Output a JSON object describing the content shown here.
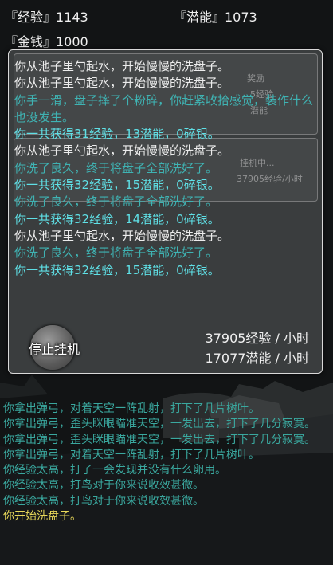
{
  "stats": {
    "exp_label": "『经验』1143",
    "potential_label": "『潜能』1073",
    "money_label": "『金钱』1000"
  },
  "ghost": {
    "reward": "奖励",
    "reward_sub": "5经验",
    "potential": "潜能",
    "idle": "挂机中...",
    "idle_rate": "37905经验/小时"
  },
  "log": [
    {
      "text": "你从池子里勺起水，开始慢慢的洗盘子。",
      "color": "white"
    },
    {
      "text": "你从池子里勺起水，开始慢慢的洗盘子。",
      "color": "white"
    },
    {
      "text": "你手一滑，盘子摔了个粉碎，你赶紧收拾感觉，装作什么也没发生。",
      "color": "teal"
    },
    {
      "text": "你一共获得31经验，13潜能，0碎银。",
      "color": "cyan"
    },
    {
      "text": "你从池子里勺起水，开始慢慢的洗盘子。",
      "color": "white"
    },
    {
      "text": "你洗了良久，终于将盘子全部洗好了。",
      "color": "teal"
    },
    {
      "text": "你一共获得32经验，15潜能，0碎银。",
      "color": "cyan"
    },
    {
      "text": "你洗了良久，终于将盘子全部洗好了。",
      "color": "teal"
    },
    {
      "text": "你一共获得32经验，14潜能，0碎银。",
      "color": "cyan"
    },
    {
      "text": "你从池子里勺起水，开始慢慢的洗盘子。",
      "color": "white"
    },
    {
      "text": "你洗了良久，终于将盘子全部洗好了。",
      "color": "teal"
    },
    {
      "text": "你一共获得32经验，15潜能，0碎银。",
      "color": "cyan"
    }
  ],
  "stop_button": "停止挂机",
  "rates": {
    "exp": "37905经验 / 小时",
    "potential": "17077潜能 / 小时"
  },
  "chat": [
    {
      "text": "你拿出弹弓，对着天空一阵乱射，打下了几片树叶。",
      "hl": false
    },
    {
      "text": "你拿出弹弓，歪头眯眼瞄准天空，一发出去，打下了几分寂寞。",
      "hl": false
    },
    {
      "text": "你拿出弹弓，歪头眯眼瞄准天空，一发出去，打下了几分寂寞。",
      "hl": false
    },
    {
      "text": "你拿出弹弓，对着天空一阵乱射，打下了几片树叶。",
      "hl": false
    },
    {
      "text": "你经验太高，打了一会发现并没有什么卵用。",
      "hl": false
    },
    {
      "text": "你经验太高，打鸟对于你来说收效甚微。",
      "hl": false
    },
    {
      "text": "你经验太高，打鸟对于你来说收效甚微。",
      "hl": false
    },
    {
      "text": "你开始洗盘子。",
      "hl": true
    }
  ],
  "colors": {
    "white": "#ececec",
    "teal": "#3fb3b3",
    "cyan": "#5fe0e6",
    "chat": "#3aa89f",
    "chat_highlight": "#e8d85a"
  }
}
